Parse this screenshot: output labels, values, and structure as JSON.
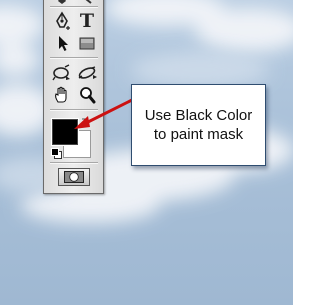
{
  "callout": {
    "line1": "Use Black Color",
    "line2": "to paint mask"
  },
  "colors": {
    "foreground": "#000000",
    "background": "#ffffff",
    "arrow": "#cc1111",
    "callout_border": "#2f4d70"
  },
  "toolbox": {
    "tools": [
      "pen-tool-icon",
      "type-tool-icon",
      "path-selection-tool-icon",
      "rectangle-tool-icon",
      "rotate-view-tool-icon",
      "3d-orbit-tool-icon",
      "hand-tool-icon",
      "zoom-tool-icon"
    ],
    "text_tool_glyph": "T"
  }
}
